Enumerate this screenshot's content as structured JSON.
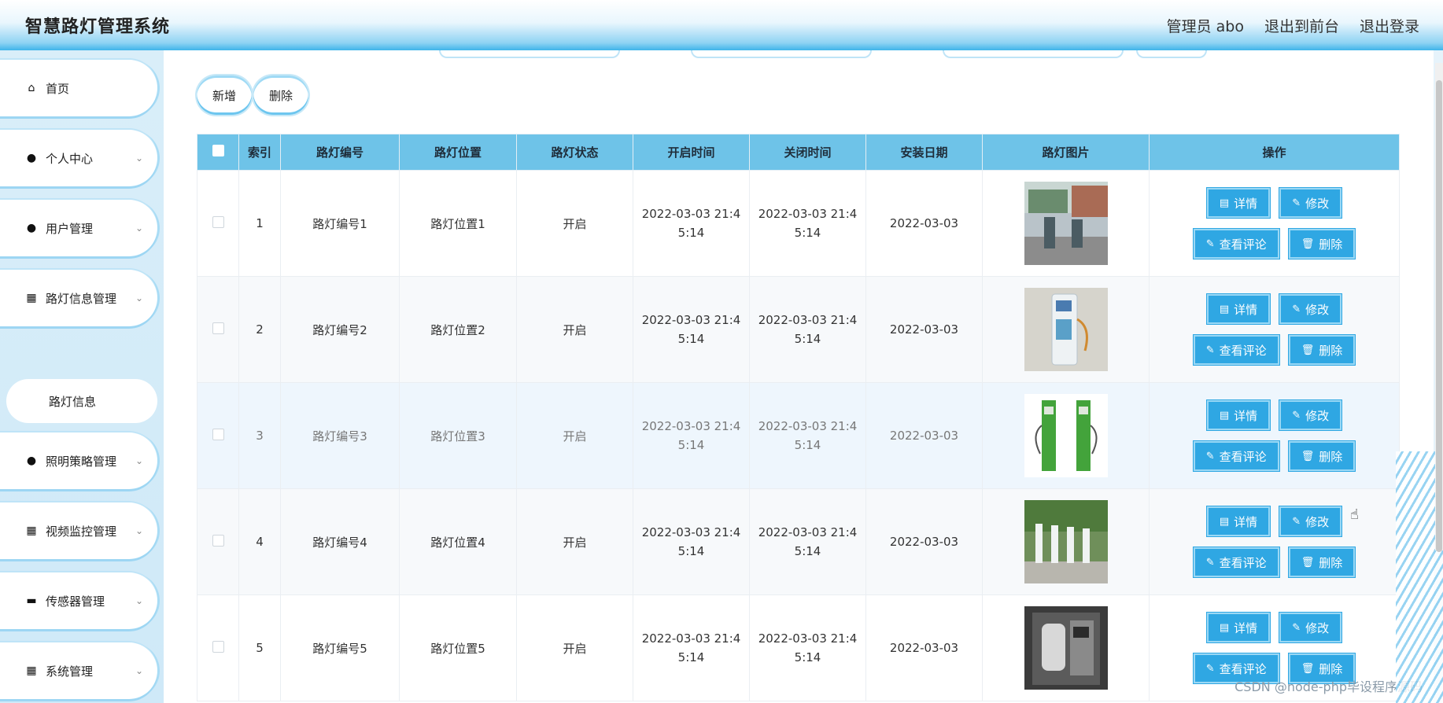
{
  "header": {
    "title": "智慧路灯管理系统",
    "admin": "管理员 abo",
    "to_front": "退出到前台",
    "logout": "退出登录"
  },
  "sidebar": {
    "items": [
      {
        "label": "首页",
        "icon": "home-icon",
        "glyph": "⌂",
        "has_children": false
      },
      {
        "label": "个人中心",
        "icon": "user-icon",
        "glyph": "●",
        "has_children": true
      },
      {
        "label": "用户管理",
        "icon": "pin-icon",
        "glyph": "●",
        "has_children": true
      },
      {
        "label": "路灯信息管理",
        "icon": "grid-icon",
        "glyph": "▦",
        "has_children": true
      },
      {
        "label": "照明策略管理",
        "icon": "user-icon",
        "glyph": "●",
        "has_children": true
      },
      {
        "label": "视频监控管理",
        "icon": "grid-icon",
        "glyph": "▦",
        "has_children": true
      },
      {
        "label": "传感器管理",
        "icon": "monitor-icon",
        "glyph": "▬",
        "has_children": true
      },
      {
        "label": "系统管理",
        "icon": "grid-icon",
        "glyph": "▦",
        "has_children": true
      }
    ],
    "submenu_label": "路灯信息",
    "chevron": "⌄"
  },
  "toolbar": {
    "add_label": "新增",
    "delete_label": "删除"
  },
  "table": {
    "headers": [
      "",
      "索引",
      "路灯编号",
      "路灯位置",
      "路灯状态",
      "开启时间",
      "关闭时间",
      "安装日期",
      "路灯图片",
      "操作"
    ],
    "rows": [
      {
        "index": "1",
        "code": "路灯编号1",
        "location": "路灯位置1",
        "status": "开启",
        "open_1": "2022-03-03 21:4",
        "open_2": "5:14",
        "close_1": "2022-03-03 21:4",
        "close_2": "5:14",
        "install_date": "2022-03-03"
      },
      {
        "index": "2",
        "code": "路灯编号2",
        "location": "路灯位置2",
        "status": "开启",
        "open_1": "2022-03-03 21:4",
        "open_2": "5:14",
        "close_1": "2022-03-03 21:4",
        "close_2": "5:14",
        "install_date": "2022-03-03"
      },
      {
        "index": "3",
        "code": "路灯编号3",
        "location": "路灯位置3",
        "status": "开启",
        "open_1": "2022-03-03 21:4",
        "open_2": "5:14",
        "close_1": "2022-03-03 21:4",
        "close_2": "5:14",
        "install_date": "2022-03-03"
      },
      {
        "index": "4",
        "code": "路灯编号4",
        "location": "路灯位置4",
        "status": "开启",
        "open_1": "2022-03-03 21:4",
        "open_2": "5:14",
        "close_1": "2022-03-03 21:4",
        "close_2": "5:14",
        "install_date": "2022-03-03"
      },
      {
        "index": "5",
        "code": "路灯编号5",
        "location": "路灯位置5",
        "status": "开启",
        "open_1": "2022-03-03 21:4",
        "open_2": "5:14",
        "close_1": "2022-03-03 21:4",
        "close_2": "5:14",
        "install_date": "2022-03-03"
      }
    ],
    "actions": {
      "detail": "详情",
      "edit": "修改",
      "comments": "查看评论",
      "delete": "删除"
    }
  },
  "watermark": "CSDN @node-php毕设程序源码",
  "colors": {
    "accent": "#2fa7e3",
    "header_th": "#6ec3e8",
    "sidebar_bg": "#d9eef9"
  }
}
